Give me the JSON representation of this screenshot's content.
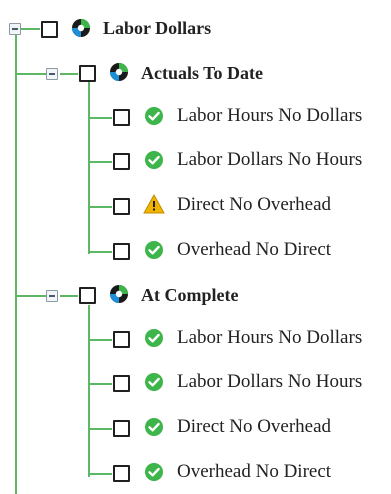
{
  "tree": {
    "root": {
      "label": "Labor Dollars",
      "icon": "project-status-icon",
      "children": [
        {
          "label": "Actuals To Date",
          "icon": "project-status-icon",
          "items": [
            {
              "label": "Labor Hours No Dollars",
              "status": "ok"
            },
            {
              "label": "Labor Dollars No Hours",
              "status": "ok"
            },
            {
              "label": "Direct No Overhead",
              "status": "warning"
            },
            {
              "label": "Overhead No Direct",
              "status": "ok"
            }
          ]
        },
        {
          "label": "At Complete",
          "icon": "project-status-icon",
          "items": [
            {
              "label": "Labor Hours No Dollars",
              "status": "ok"
            },
            {
              "label": "Labor Dollars No Hours",
              "status": "ok"
            },
            {
              "label": "Direct No Overhead",
              "status": "ok"
            },
            {
              "label": "Overhead No Direct",
              "status": "ok"
            }
          ]
        }
      ]
    },
    "colors": {
      "connector": "#5cb865",
      "ok": "#3db54a",
      "warning": "#f0b400"
    }
  }
}
